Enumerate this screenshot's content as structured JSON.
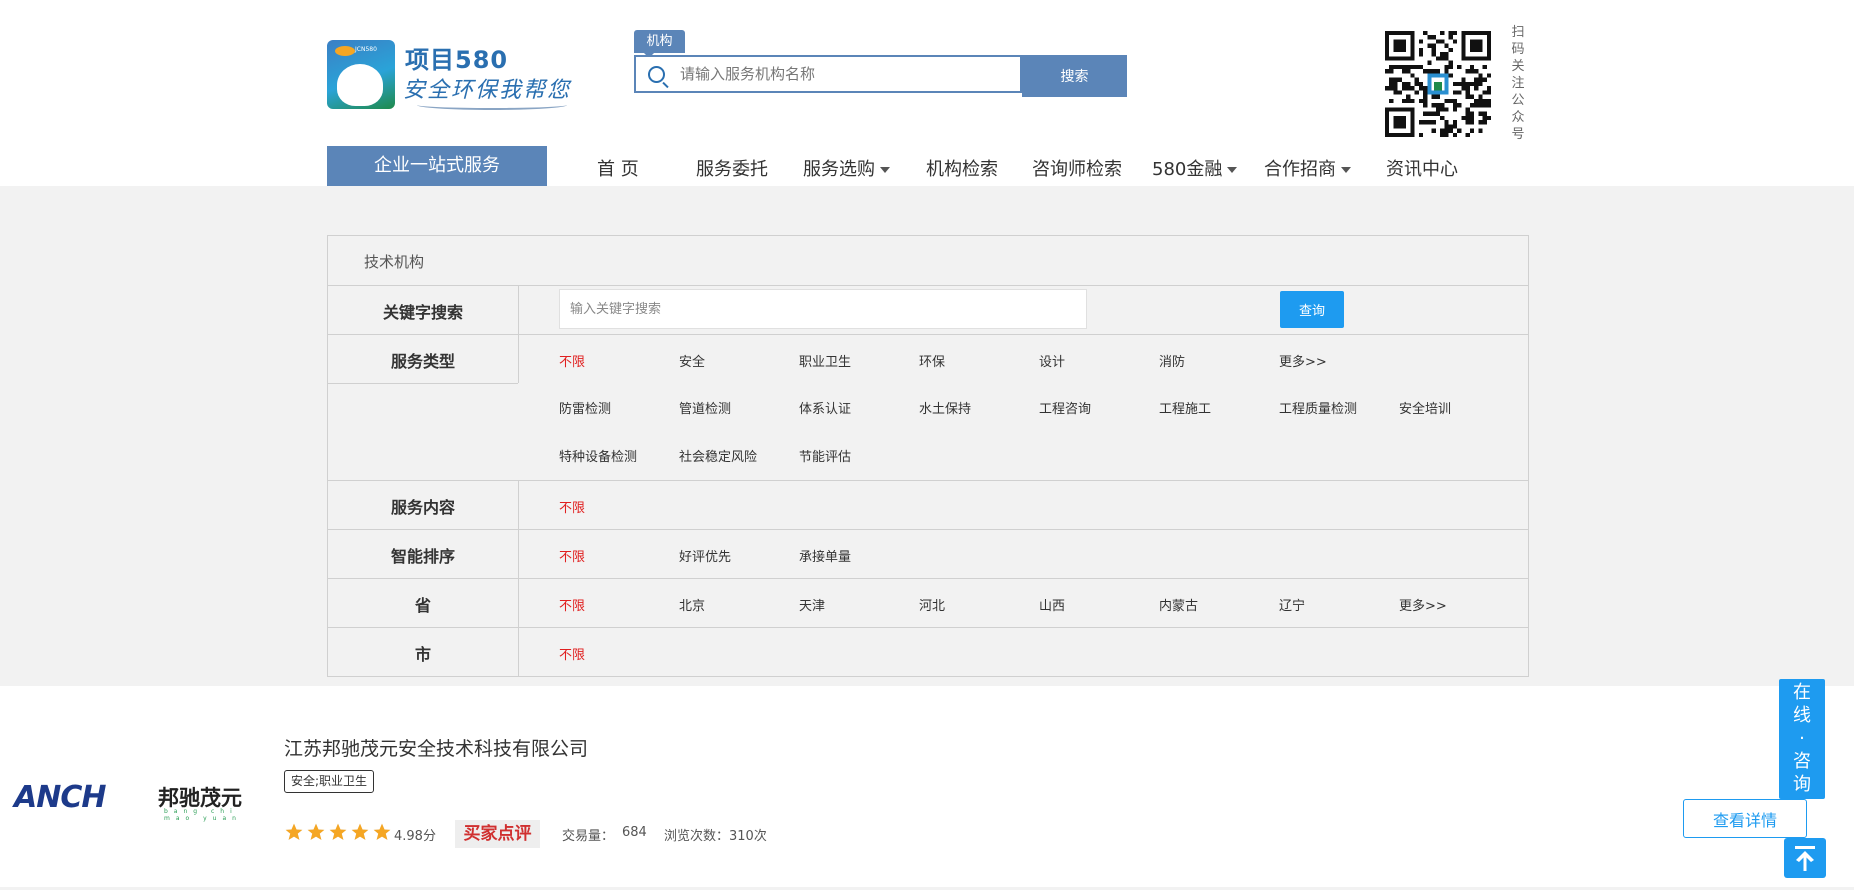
{
  "header": {
    "logo": {
      "title": "项目580",
      "subtitle": "安全环保我帮您",
      "mini": "JCN580"
    },
    "search": {
      "tag": "机构",
      "placeholder": "请输入服务机构名称",
      "button": "搜索"
    },
    "qr_text": "扫码关注公众号"
  },
  "nav": {
    "cta": "企业一站式服务",
    "items": [
      {
        "label": "首 页",
        "dropdown": false
      },
      {
        "label": "服务委托",
        "dropdown": false
      },
      {
        "label": "服务选购",
        "dropdown": true
      },
      {
        "label": "机构检索",
        "dropdown": false
      },
      {
        "label": "咨询师检索",
        "dropdown": false
      },
      {
        "label": "580金融",
        "dropdown": true
      },
      {
        "label": "合作招商",
        "dropdown": true
      },
      {
        "label": "资讯中心",
        "dropdown": false
      }
    ]
  },
  "filter": {
    "title": "技术机构",
    "keyword": {
      "label": "关键字搜索",
      "placeholder": "输入关键字搜索",
      "button": "查询"
    },
    "service_type": {
      "label": "服务类型",
      "options": [
        [
          "不限",
          "安全",
          "职业卫生",
          "环保",
          "设计",
          "消防",
          "更多>>"
        ],
        [
          "防雷检测",
          "管道检测",
          "体系认证",
          "水土保持",
          "工程咨询",
          "工程施工",
          "工程质量检测",
          "安全培训"
        ],
        [
          "特种设备检测",
          "社会稳定风险",
          "节能评估"
        ]
      ]
    },
    "service_content": {
      "label": "服务内容",
      "options": [
        "不限"
      ]
    },
    "sort": {
      "label": "智能排序",
      "options": [
        "不限",
        "好评优先",
        "承接单量"
      ]
    },
    "province": {
      "label": "省",
      "options": [
        "不限",
        "北京",
        "天津",
        "河北",
        "山西",
        "内蒙古",
        "辽宁",
        "更多>>"
      ]
    },
    "city": {
      "label": "市",
      "options": [
        "不限"
      ]
    }
  },
  "listing": {
    "logo": {
      "latin": "ANCH",
      "cn": "邦驰茂元",
      "pinyin": "bang chi mao yuan"
    },
    "name": "江苏邦驰茂元安全技术科技有限公司",
    "tag": "安全;职业卫生",
    "rating": 4.98,
    "score_text": "4.98分",
    "review_badge": "买家点评",
    "trade_count_label": "交易量：",
    "trade_count": "684",
    "views_text": "浏览次数：310次",
    "detail_button": "查看详情"
  },
  "float": {
    "consult": [
      "在",
      "线",
      "·",
      "咨",
      "询"
    ]
  },
  "colors": {
    "brand": "#5b85b8",
    "accent": "#1e9bf0",
    "active": "#e02020",
    "band": "#f2f2f2",
    "star": "#f5a623"
  }
}
